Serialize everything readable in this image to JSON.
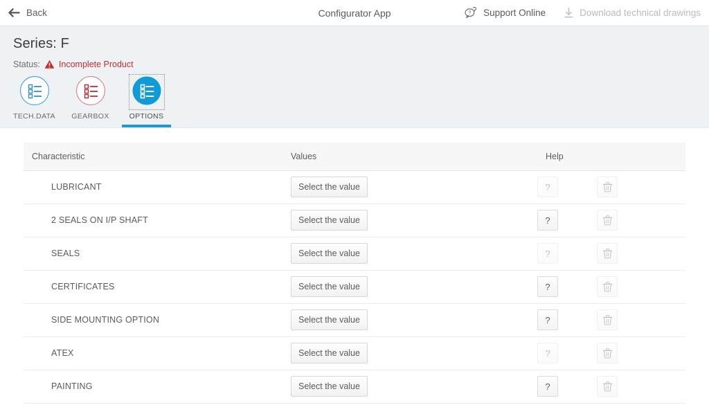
{
  "topbar": {
    "back_label": "Back",
    "back_icon": "arrow-left-icon",
    "app_title": "Configurator App",
    "support": {
      "label": "Support Online",
      "icon": "support-chat-question-icon",
      "enabled": true
    },
    "download": {
      "label": "Download technical drawings",
      "icon": "download-arrow-icon",
      "enabled": false
    }
  },
  "header": {
    "series_title": "Series: F",
    "status_label": "Status:",
    "status_value": "Incomplete Product",
    "status_icon": "warning-triangle-icon",
    "status_color": "#cc2b29"
  },
  "tabs": [
    {
      "label": "TECH.DATA",
      "icon": "checklist-icon",
      "active": false,
      "color": "#2196c9",
      "style": "outline"
    },
    {
      "label": "GEARBOX",
      "icon": "checklist-icon",
      "active": false,
      "color": "#c0392b",
      "style": "outline"
    },
    {
      "label": "OPTIONS",
      "icon": "checklist-icon",
      "active": true,
      "color": "#0e9bd8",
      "style": "filled"
    }
  ],
  "table": {
    "headers": [
      "Characteristic",
      "Values",
      "Help"
    ],
    "select_label": "Select the value",
    "help_glyph": "?",
    "delete_icon": "trash-icon",
    "rows": [
      {
        "characteristic": "LUBRICANT",
        "value_button": "Select the value",
        "help_enabled": false
      },
      {
        "characteristic": "2 SEALS ON I/P SHAFT",
        "value_button": "Select the value",
        "help_enabled": true
      },
      {
        "characteristic": "SEALS",
        "value_button": "Select the value",
        "help_enabled": false
      },
      {
        "characteristic": "CERTIFICATES",
        "value_button": "Select the value",
        "help_enabled": true
      },
      {
        "characteristic": "SIDE MOUNTING OPTION",
        "value_button": "Select the value",
        "help_enabled": true
      },
      {
        "characteristic": "ATEX",
        "value_button": "Select the value",
        "help_enabled": false
      },
      {
        "characteristic": "PAINTING",
        "value_button": "Select the value",
        "help_enabled": true
      }
    ]
  },
  "theme": {
    "accent": "#0e9bd8",
    "header_bg": "#eef2f5",
    "danger": "#cc2b29"
  }
}
